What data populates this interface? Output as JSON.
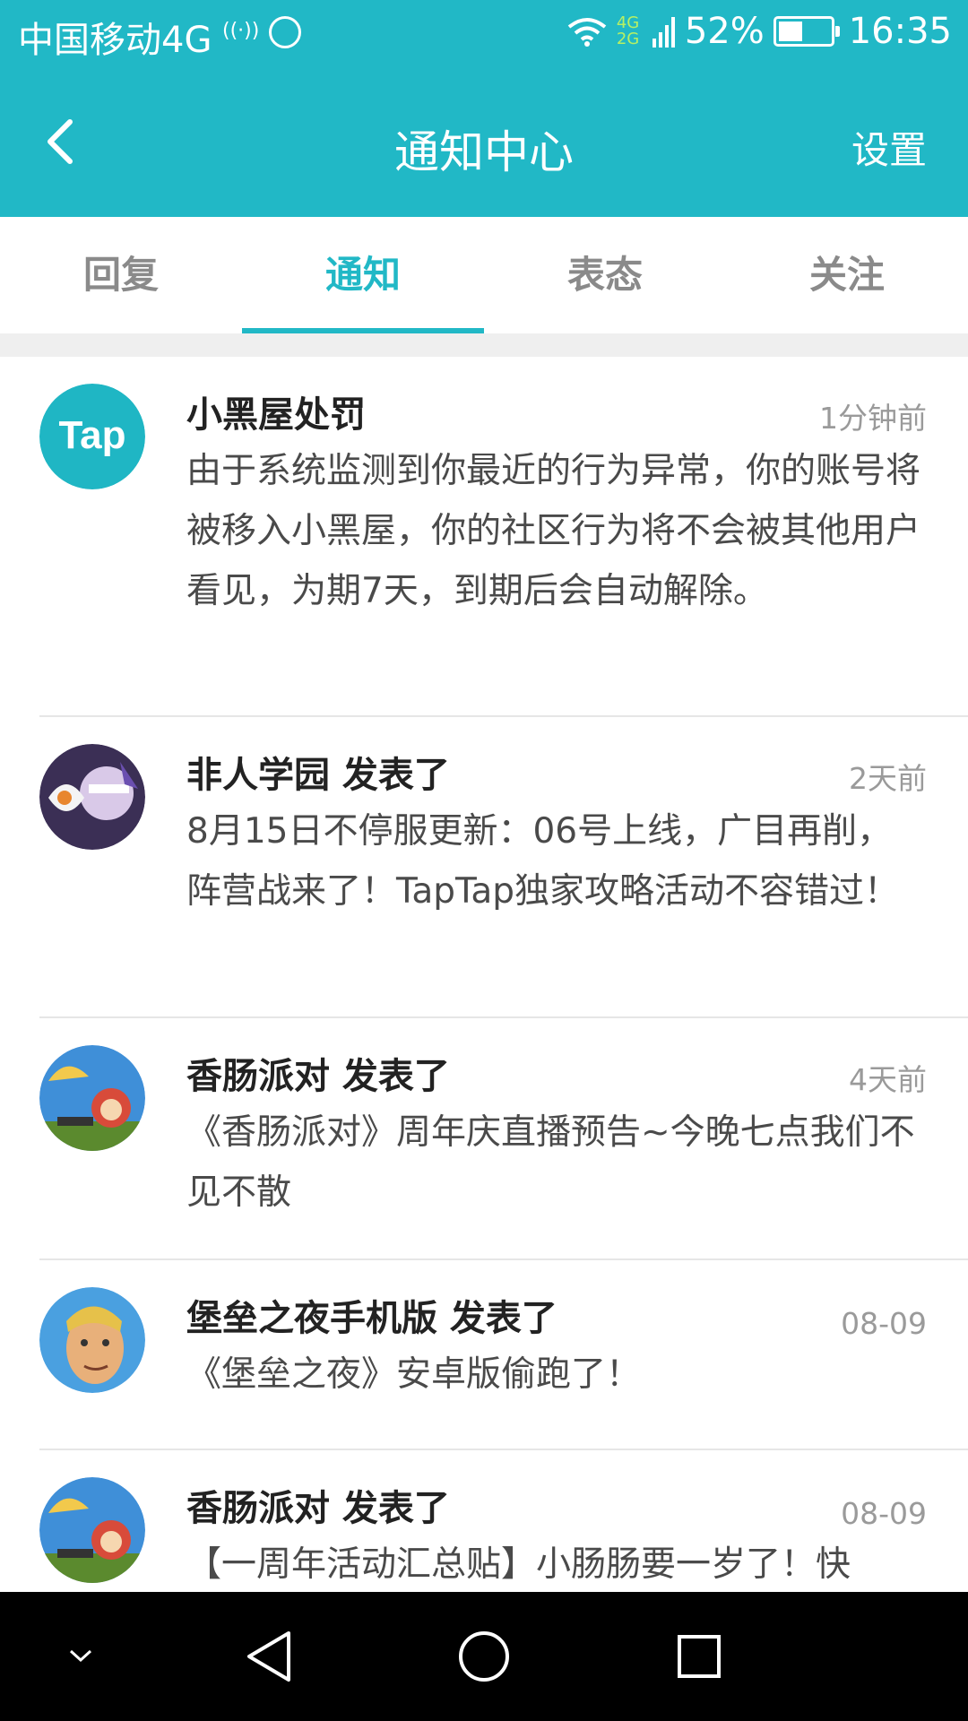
{
  "status_bar": {
    "carrier": "中国移动4G",
    "signal_label": "4G 2G",
    "battery": "52%",
    "battery_level": 0.52,
    "time": "16:35"
  },
  "nav": {
    "title": "通知中心",
    "settings_label": "设置"
  },
  "tabs": [
    {
      "label": "回复",
      "active": false
    },
    {
      "label": "通知",
      "active": true
    },
    {
      "label": "表态",
      "active": false
    },
    {
      "label": "关注",
      "active": false
    }
  ],
  "notifications": [
    {
      "avatar": "tap-logo",
      "title": "小黑屋处罚",
      "time": "1分钟前",
      "body": "由于系统监测到你最近的行为异常，你的账号将被移入小黑屋，你的社区行为将不会被其他用户看见，为期7天，到期后会自动解除。"
    },
    {
      "avatar": "game-avatar-feiren",
      "title": "非人学园 发表了",
      "time": "2天前",
      "body": "8月15日不停服更新：06号上线，广目再削，阵营战来了！TapTap独家攻略活动不容错过！"
    },
    {
      "avatar": "game-avatar-xiangchang",
      "title": "香肠派对 发表了",
      "time": "4天前",
      "body": "《香肠派对》周年庆直播预告~今晚七点我们不见不散"
    },
    {
      "avatar": "game-avatar-fortnite",
      "title": "堡垒之夜手机版 发表了",
      "time": "08-09",
      "body": "《堡垒之夜》安卓版偷跑了！"
    },
    {
      "avatar": "game-avatar-xiangchang",
      "title": "香肠派对 发表了",
      "time": "08-09",
      "body": "【一周年活动汇总贴】小肠肠要一岁了！快"
    }
  ],
  "colors": {
    "accent": "#21b8c6"
  }
}
